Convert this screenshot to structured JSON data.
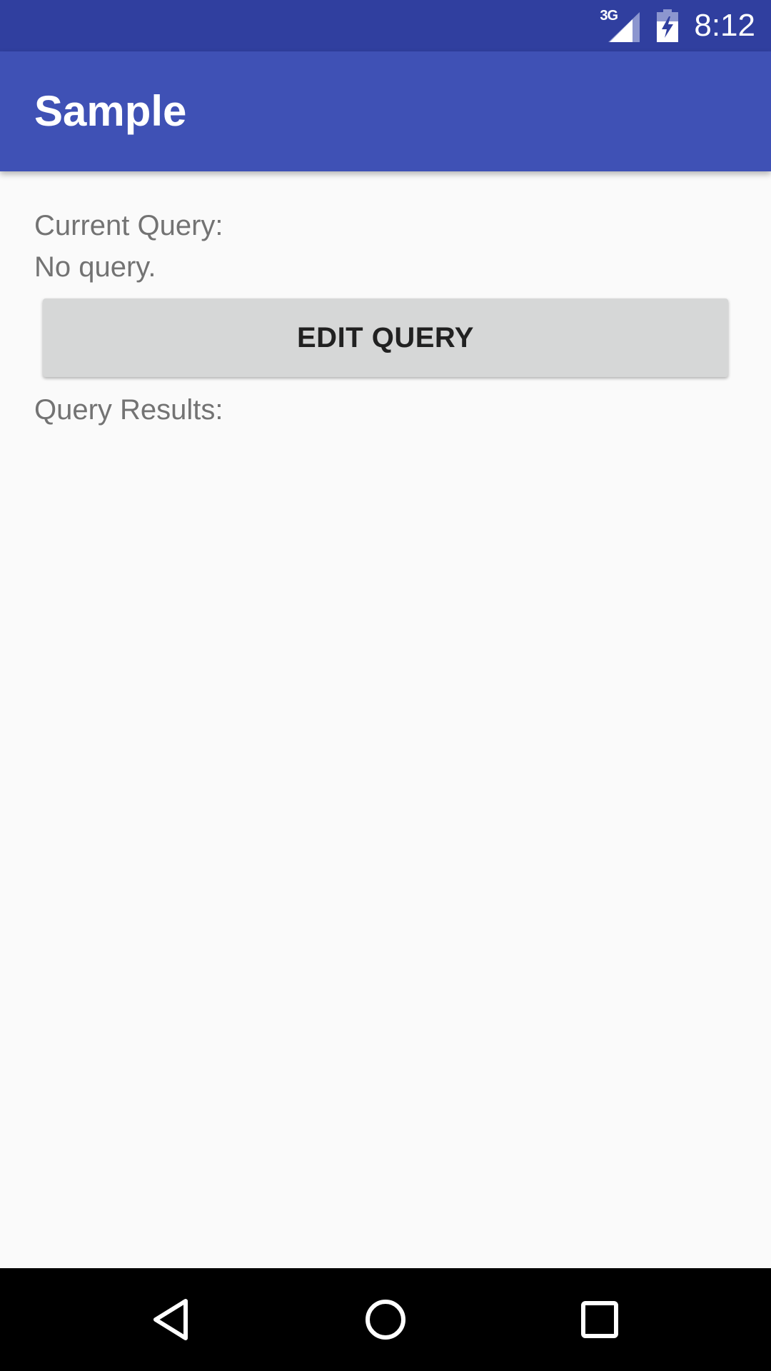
{
  "status_bar": {
    "network_type": "3G",
    "time": "8:12",
    "icons": [
      "signal-icon",
      "battery-charging-icon"
    ],
    "background_color": "#303f9f"
  },
  "app_bar": {
    "title": "Sample",
    "background_color": "#3f51b5"
  },
  "content": {
    "current_query_label": "Current Query:",
    "current_query_value": "No query.",
    "edit_button_label": "EDIT QUERY",
    "results_label": "Query Results:"
  },
  "nav_bar": {
    "icons": [
      "back-icon",
      "home-icon",
      "recents-icon"
    ]
  }
}
